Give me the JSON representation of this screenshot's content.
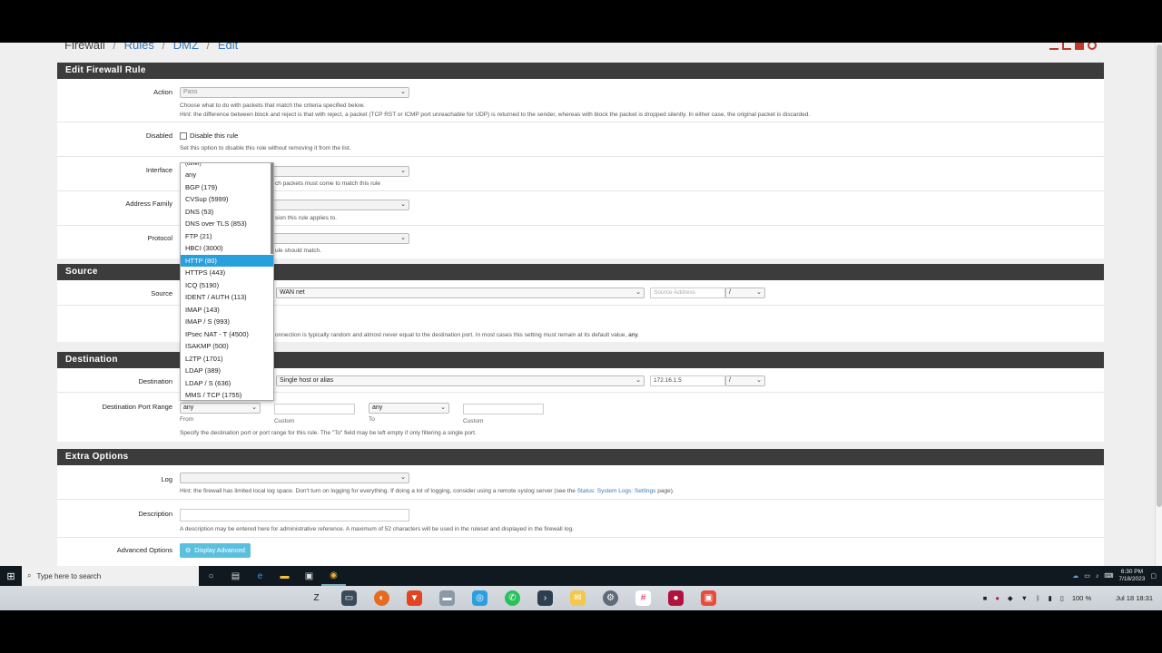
{
  "breadcrumb": {
    "root": "Firewall",
    "rules": "Rules",
    "dmz": "DMZ",
    "edit": "Edit",
    "separator": "/"
  },
  "edit_panel": {
    "title": "Edit Firewall Rule",
    "action": {
      "label": "Action",
      "value": "Pass",
      "help1": "Choose what to do with packets that match the criteria specified below.",
      "help2": "Hint: the difference between block and reject is that with reject, a packet (TCP RST or ICMP port unreachable for UDP) is returned to the sender, whereas with block the packet is dropped silently. In either case, the original packet is discarded."
    },
    "disabled": {
      "label": "Disabled",
      "checkbox": "Disable this rule",
      "help": "Set this option to disable this rule without removing it from the list."
    },
    "interface": {
      "label": "Interface",
      "help": "ch packets must come to match this rule"
    },
    "address_family": {
      "label": "Address Family",
      "help": "sion this rule applies to."
    },
    "protocol": {
      "label": "Protocol",
      "help": "ule should match."
    }
  },
  "source_panel": {
    "title": "Source",
    "label": "Source",
    "type_value": "WAN net",
    "address_placeholder": "Source Address",
    "slash": "/",
    "help": "onnection is typically random and almost never equal to the destination port. In most cases this setting must remain at its default value,",
    "help_bold": "any",
    "help_end": "."
  },
  "destination_panel": {
    "title": "Destination",
    "label": "Destination",
    "type_value": "Single host or alias",
    "address_value": "172.16.1.5",
    "slash": "/",
    "port_range_label": "Destination Port Range",
    "from_value": "any",
    "to_value": "any",
    "from_label": "From",
    "custom_label": "Custom",
    "to_label": "To",
    "help": "Specify the destination port or port range for this rule. The \"To\" field may be left empty if only filtering a single port."
  },
  "extra_panel": {
    "title": "Extra Options",
    "log_label": "Log",
    "log_help_pre": "Hint: the firewall has limited local log space. Don't turn on logging for everything. If doing a lot of logging, consider using a remote syslog server (see the",
    "log_help_link": "Status: System Logs: Settings",
    "log_help_post": "page).",
    "description_label": "Description",
    "description_help": "A description may be entered here for administrative reference. A maximum of 52 characters will be used in the ruleset and displayed in the firewall log.",
    "advanced_label": "Advanced Options",
    "advanced_button": "Display Advanced"
  },
  "dropdown": {
    "partial_top": "(other)",
    "options": [
      "any",
      "BGP (179)",
      "CVSup (5999)",
      "DNS (53)",
      "DNS over TLS (853)",
      "FTP (21)",
      "HBCI (3000)",
      "HTTP (80)",
      "HTTPS (443)",
      "ICQ (5190)",
      "IDENT / AUTH (113)",
      "IMAP (143)",
      "IMAP / S (993)",
      "IPsec NAT - T (4500)",
      "ISAKMP (500)",
      "L2TP (1701)",
      "LDAP (389)",
      "LDAP / S (636)",
      "MMS / TCP (1755)"
    ],
    "highlighted": "HTTP (80)"
  },
  "taskbar": {
    "search_placeholder": "Type here to search",
    "time": "6:30 PM",
    "date": "7/18/2023"
  },
  "dock": {
    "battery": "100 %",
    "datetime": "Jul 18  18:31"
  },
  "colors": {
    "panel_header": "#3c3c3c",
    "link": "#3a7ab8",
    "highlight": "#29a0de",
    "button": "#5bc0de"
  }
}
